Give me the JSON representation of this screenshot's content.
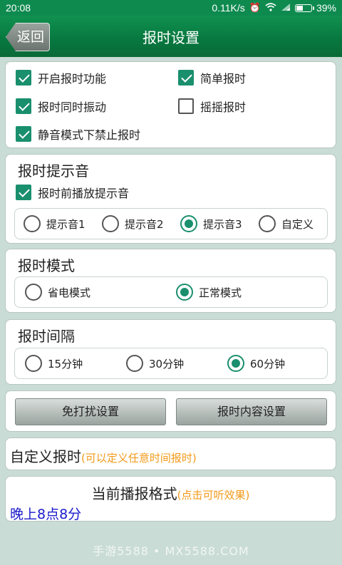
{
  "status_bar": {
    "time": "20:08",
    "network_speed": "0.11K/s",
    "battery": "39%",
    "battery_level": 0.39
  },
  "header": {
    "back_label": "返回",
    "title": "报时设置"
  },
  "options": {
    "enable": "开启报时功能",
    "simple": "简单报时",
    "vibrate": "报时同时振动",
    "shake": "摇摇报时",
    "silent": "静音模式下禁止报时"
  },
  "prompt_sound": {
    "title": "报时提示音",
    "play_before": "报时前播放提示音",
    "choices": [
      "提示音1",
      "提示音2",
      "提示音3",
      "自定义"
    ],
    "selected": "提示音3"
  },
  "mode": {
    "title": "报时模式",
    "choices": [
      "省电模式",
      "正常模式"
    ],
    "selected": "正常模式"
  },
  "interval": {
    "title": "报时间隔",
    "choices": [
      "15分钟",
      "30分钟",
      "60分钟"
    ],
    "selected": "60分钟"
  },
  "buttons": {
    "dnd": "免打扰设置",
    "content": "报时内容设置"
  },
  "custom": {
    "label": "自定义报时",
    "hint": "(可以定义任意时间报时)"
  },
  "format": {
    "label": "当前播报格式",
    "hint": "(点击可听效果)",
    "value": "晚上8点8分"
  },
  "watermark": "手游5588 • MX5588.COM",
  "colors": {
    "accent": "#1a8f6d",
    "header": "#0e8a4f",
    "hint": "#f39a1a",
    "format_value": "#1a1acc"
  }
}
